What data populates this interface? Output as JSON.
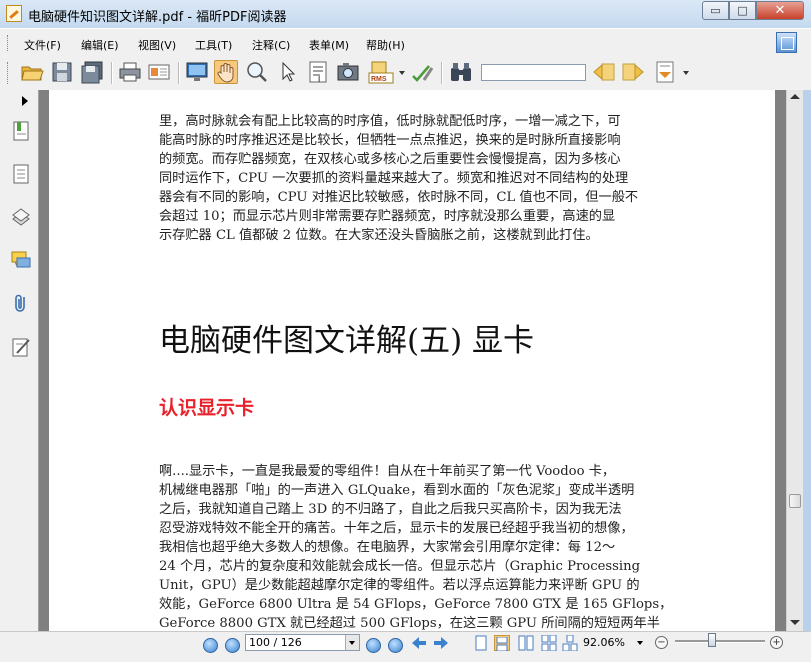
{
  "window": {
    "title": "电脑硬件知识图文详解.pdf - 福昕PDF阅读器",
    "minimize_glyph": "▭",
    "maximize_glyph": "□",
    "close_glyph": "✕"
  },
  "menu": {
    "items": [
      "文件(F)",
      "编辑(E)",
      "视图(V)",
      "工具(T)",
      "注释(C)",
      "表单(M)",
      "帮助(H)"
    ]
  },
  "toolbar": {
    "icons": [
      "open-folder-icon",
      "save-icon",
      "save-as-icon",
      "print-icon",
      "email-icon",
      "fullscreen-icon",
      "hand-tool-icon",
      "zoom-tool-icon",
      "select-arrow-icon",
      "text-select-icon",
      "snapshot-icon",
      "rms-icon",
      "sign-icon",
      "find-binoculars-icon",
      "find-previous-icon",
      "find-next-icon",
      "document-options-icon"
    ],
    "search_value": "",
    "rms_label": "RMS"
  },
  "document": {
    "para1": [
      "里，高时脉就会有配上比较高的时序值，低时脉就配低时序，一增一减之下，可",
      "能高时脉的时序推迟还是比较长，但牺牲一点点推迟，换来的是时脉所直接影响",
      "的频宽。而存贮器频宽，在双核心或多核心之后重要性会慢慢提高，因为多核心",
      "同时运作下，CPU 一次要抓的资料量越来越大了。频宽和推迟对不同结构的处理",
      "器会有不同的影响，CPU 对推迟比较敏感，依时脉不同，CL 值也不同，但一般不",
      "会超过 10；而显示芯片则非常需要存贮器频宽，时序就没那么重要，高速的显",
      "示存贮器 CL 值都破 2 位数。在大家还没头昏脑胀之前，这楼就到此打住。"
    ],
    "heading": "电脑硬件图文详解(五) 显卡",
    "subheading": "认识显示卡",
    "para2": [
      "啊....显示卡，一直是我最爱的零组件！自从在十年前买了第一代 Voodoo 卡，",
      "机械继电器那「啪」的一声进入 GLQuake，看到水面的「灰色泥浆」变成半透明",
      "之后，我就知道自己踏上 3D 的不归路了，自此之后我只买高阶卡，因为我无法",
      "忍受游戏特效不能全开的痛苦。十年之后，显示卡的发展已经超乎我当初的想像，",
      "我相信也超乎绝大多数人的想像。在电脑界，大家常会引用摩尔定律：每 12～",
      "24 个月，芯片的复杂度和效能就会成长一倍。但显示芯片（Graphic Processing",
      "Unit，GPU）是少数能超越摩尔定律的零组件。若以浮点运算能力来评断 GPU 的",
      "效能，GeForce 6800 Ultra 是 54 GFlops，GeForce 7800 GTX 是 165 GFlops，",
      "GeForce 8800 GTX 就已经超过 500 GFlops，在这三颗 GPU 所间隔的短短两年半"
    ]
  },
  "statusbar": {
    "page_value": "100 / 126",
    "zoom_value": "92.06%",
    "zoom_fraction": 0.45
  },
  "colors": {
    "subheading": "#e8212b",
    "titlebar": "#c4d9ef",
    "canvas": "#808080"
  }
}
